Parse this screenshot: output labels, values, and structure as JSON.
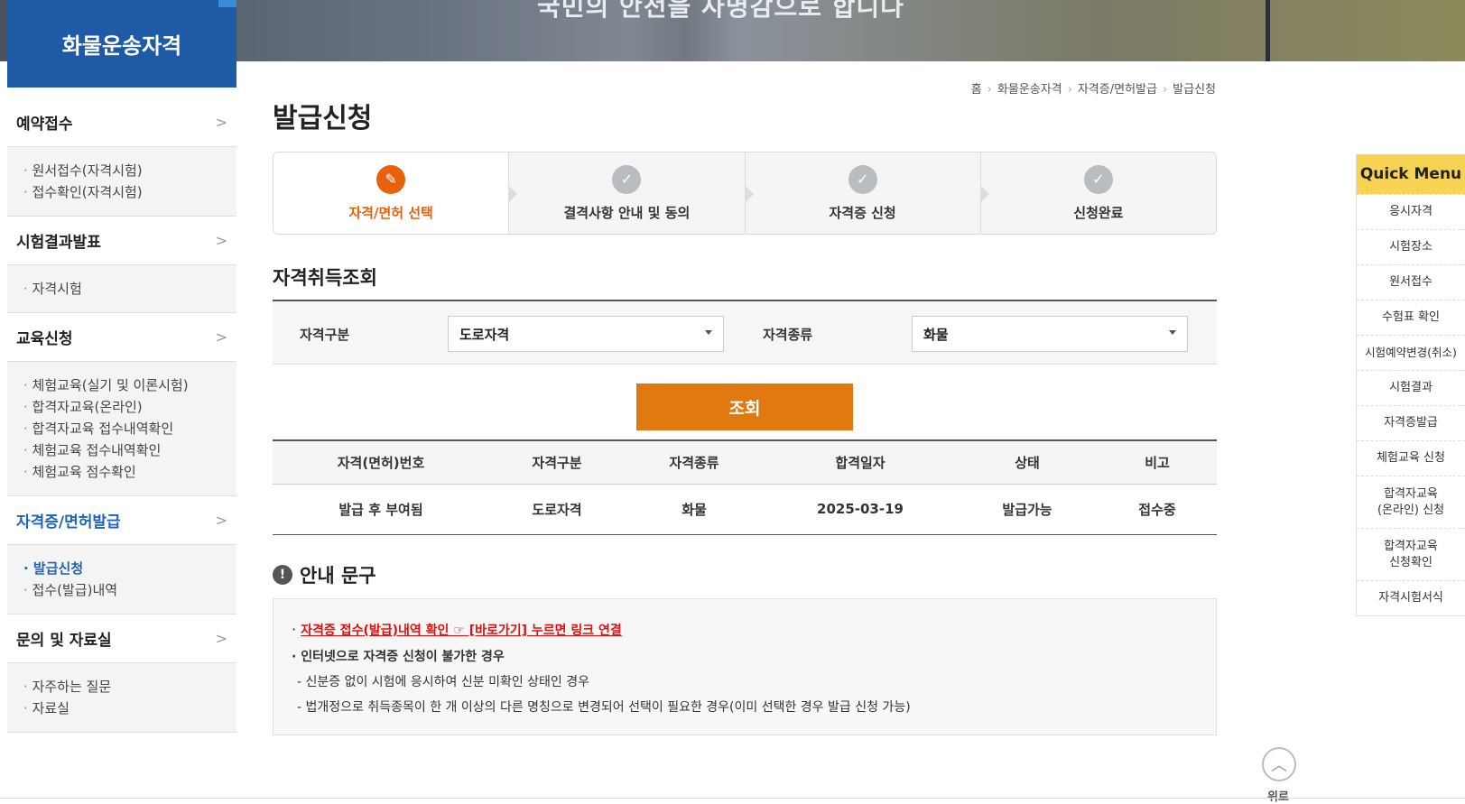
{
  "banner": {
    "slogan": "국민의 안전을 사명감으로 합니다"
  },
  "sidebar": {
    "title": "화물운송자격",
    "sections": [
      {
        "label": "예약접수",
        "items": [
          "원서접수(자격시험)",
          "접수확인(자격시험)"
        ]
      },
      {
        "label": "시험결과발표",
        "items": [
          "자격시험"
        ]
      },
      {
        "label": "교육신청",
        "items": [
          "체험교육(실기 및 이론시험)",
          "합격자교육(온라인)",
          "합격자교육 접수내역확인",
          "체험교육 접수내역확인",
          "체험교육 점수확인"
        ]
      },
      {
        "label": "자격증/면허발급",
        "items": [
          "발급신청",
          "접수(발급)내역"
        ]
      },
      {
        "label": "문의 및 자료실",
        "items": [
          "자주하는 질문",
          "자료실"
        ]
      }
    ],
    "chevron": ">"
  },
  "breadcrumb": [
    "홈",
    "화물운송자격",
    "자격증/면허발급",
    "발급신청"
  ],
  "page_title": "발급신청",
  "steps": [
    {
      "label": "자격/면허 선택",
      "icon": "pencil-icon",
      "active": true
    },
    {
      "label": "결격사항 안내 및 동의",
      "icon": "check-icon",
      "active": false
    },
    {
      "label": "자격증 신청",
      "icon": "check-icon",
      "active": false
    },
    {
      "label": "신청완료",
      "icon": "check-icon",
      "active": false
    }
  ],
  "search": {
    "title": "자격취득조회",
    "category_label": "자격구분",
    "category_value": "도로자격",
    "type_label": "자격종류",
    "type_value": "화물",
    "button": "조회"
  },
  "table": {
    "headers": [
      "자격(면허)번호",
      "자격구분",
      "자격종류",
      "합격일자",
      "상태",
      "비고"
    ],
    "rows": [
      [
        "발급 후 부여됨",
        "도로자격",
        "화물",
        "2025-03-19",
        "발급가능",
        "접수중"
      ]
    ]
  },
  "notice": {
    "title": "안내 문구",
    "link": "자격증 접수(발급)내역 확인 ☞ [바로가기] 누르면 링크 연결",
    "lines": [
      "인터넷으로 자격증 신청이 불가한 경우",
      "- 신분증 없이 시험에 응시하여 신분 미확인 상태인 경우",
      "- 법개정으로 취득종목이 한 개 이상의 다른 명칭으로 변경되어 선택이 필요한 경우(이미 선택한 경우 발급 신청 가능)"
    ]
  },
  "quick_menu": {
    "title": "Quick Menu",
    "items": [
      "응시자격",
      "시험장소",
      "원서접수",
      "수험표 확인",
      "시험예약변경(취소)",
      "시험결과",
      "자격증발급",
      "체험교육 신청",
      "합격자교육\n(온라인) 신청",
      "합격자교육\n신청확인",
      "자격시험서식"
    ]
  },
  "top_button": "위로",
  "colors": {
    "accent": "#e8610c",
    "brand": "#1f5aa6",
    "quick": "#f7d353"
  }
}
